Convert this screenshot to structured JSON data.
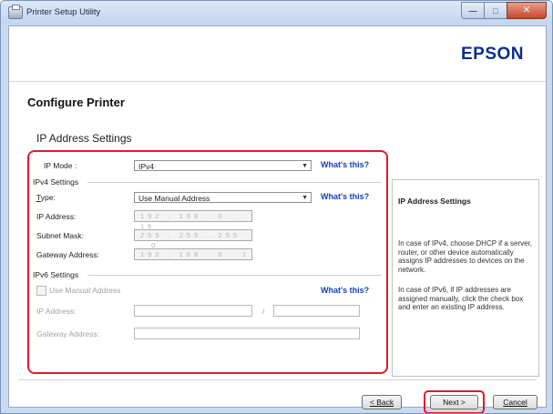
{
  "window": {
    "title": "Printer Setup Utility"
  },
  "header": {
    "logo": "EPSON"
  },
  "page": {
    "title": "Configure Printer",
    "section_title": "IP Address Settings"
  },
  "ip_mode": {
    "label": "IP Mode :",
    "value": "IPv4",
    "whats_this": "What's this?"
  },
  "ipv4": {
    "group_label": "IPv4 Settings",
    "type_label": "Type:",
    "type_value": "Use Manual Address",
    "whats_this": "What's this?",
    "ip_label": "IP Address:",
    "ip_value": "192 . 168 . 0 . 16",
    "subnet_label": "Subnet Mask:",
    "subnet_value": "255 . 255 . 255 . 0",
    "gateway_label": "Gateway Address:",
    "gateway_value": "192 . 168 . 0 . 1"
  },
  "ipv6": {
    "group_label": "IPv6 Settings",
    "manual_label": "Use Manual Address",
    "whats_this": "What's this?",
    "ip_label": "IP Address:",
    "prefix_sep": "/",
    "gateway_label": "Gateway Address:"
  },
  "sidebar": {
    "title": "IP Address Settings",
    "p1": "In case of IPv4, choose DHCP if a server, router, or other device automatically assigns IP addresses to devices on the network.",
    "p2": "In case of IPv6, if IP addresses are assigned manually, click the check box and enter an existing IP address."
  },
  "footer": {
    "back": "< Back",
    "next": "Next >",
    "cancel": "Cancel"
  }
}
